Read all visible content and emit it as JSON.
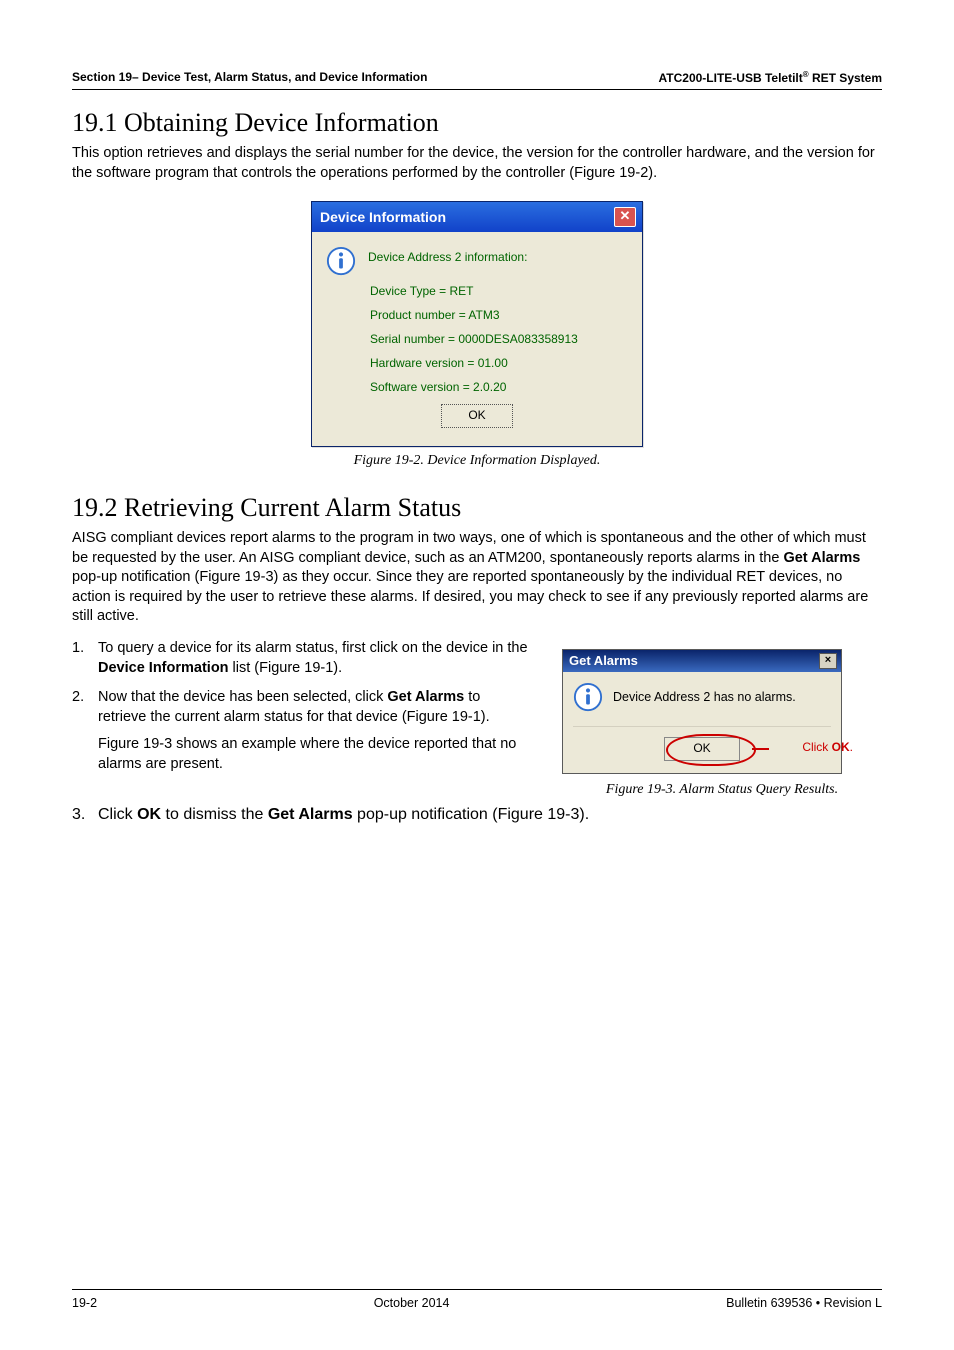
{
  "header": {
    "left": "Section 19– Device Test, Alarm Status, and Device Information",
    "right_prefix": "ATC200-LITE-USB Teletilt",
    "right_suffix": " RET System",
    "right_sup": "®"
  },
  "sec19_1": {
    "title": "19.1 Obtaining Device Information",
    "para": "This option retrieves and displays the serial number for the device, the version for the controller hardware, and the version for the software program that controls the operations performed by the controller (Figure 19-2)."
  },
  "dialog1": {
    "title": "Device Information",
    "close": "✕",
    "line0": "Device Address 2 information:",
    "line1": "Device Type = RET",
    "line2": "Product number = ATM3",
    "line3": "Serial number = 0000DESA083358913",
    "line4": "Hardware version = 01.00",
    "line5": "Software version = 2.0.20",
    "ok": "OK"
  },
  "fig2_caption": "Figure 19-2. Device Information Displayed.",
  "sec19_2": {
    "title": "19.2 Retrieving Current Alarm Status",
    "para1": "AISG compliant devices report alarms to the program in two ways, one of which is spontaneous and the other of which must be requested by the user. An AISG compliant device, such as an ATM200, spontaneously reports alarms in the ",
    "para1_bold": "Get Alarms",
    "para1_cont": " pop-up notification (Figure 19-3) as they occur. Since they are reported spontaneously by the individual RET devices, no action is required by the user to retrieve these alarms. If desired, you may check to see if any previously reported alarms are still active.",
    "step1_a": "To query a device for its alarm status, first click on the device in the ",
    "step1_b": "Device Information",
    "step1_c": " list (Figure 19-1).",
    "step2_a": "Now that the device has been selected, click ",
    "step2_b": "Get Alarms",
    "step2_c": " to retrieve the current alarm status for that device (Figure 19-1).",
    "step2_sub": "Figure 19-3 shows an example where the device reported that no alarms are present.",
    "step3_a": "Click ",
    "step3_b": "OK",
    "step3_c": " to dismiss the ",
    "step3_d": "Get Alarms",
    "step3_e": " pop-up notification (Figure 19-3)."
  },
  "dialog2": {
    "title": "Get Alarms",
    "close": "×",
    "msg": "Device Address 2 has no alarms.",
    "ok": "OK",
    "callout_pre": "Click ",
    "callout_bold": "OK",
    "callout_post": "."
  },
  "fig3_caption": "Figure 19-3. Alarm Status Query Results.",
  "footer": {
    "left": "19-2",
    "mid_a": "October ",
    "mid_b": "2014",
    "right": "Bulletin 639536  •  Revision L"
  }
}
